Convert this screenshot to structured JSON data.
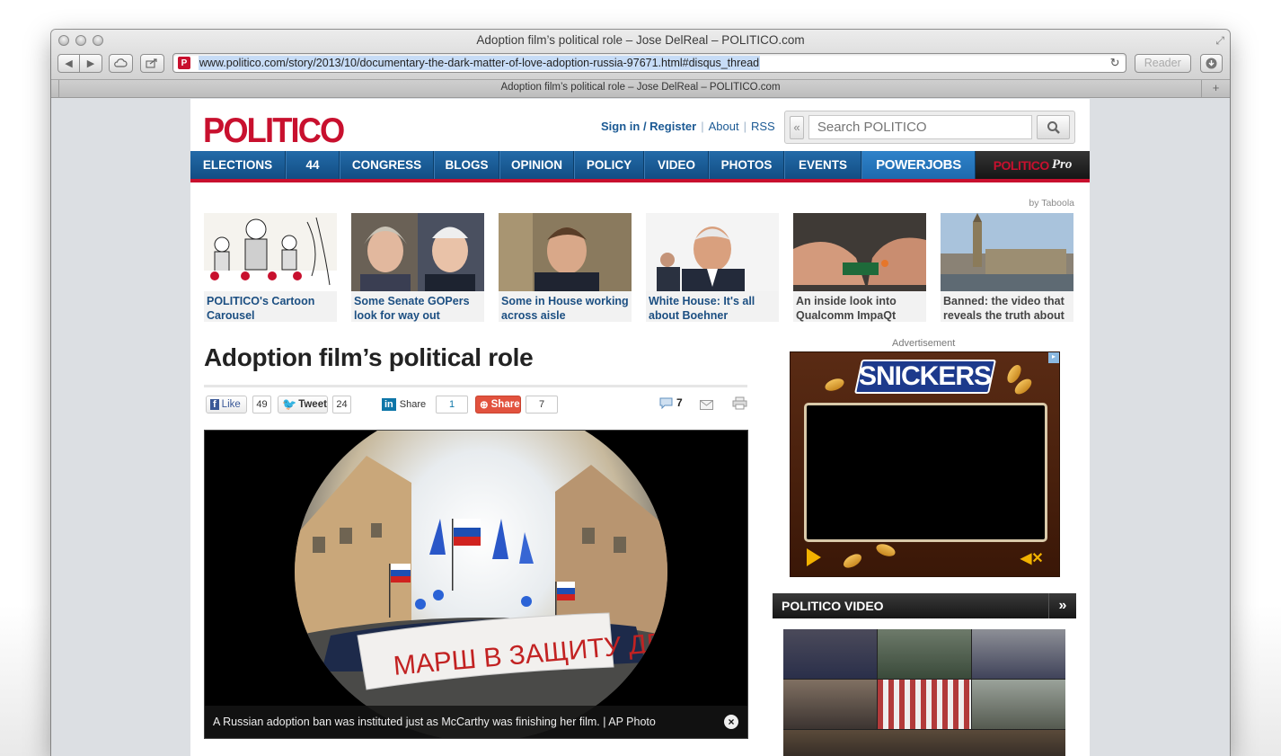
{
  "window": {
    "title": "Adoption film’s political role – Jose DelReal – POLITICO.com",
    "url": "www.politico.com/story/2013/10/documentary-the-dark-matter-of-love-adoption-russia-97671.html#disqus_thread",
    "reader_label": "Reader",
    "tab_title": "Adoption film’s political role – Jose DelReal – POLITICO.com"
  },
  "header": {
    "logo": "POLITICO",
    "signin": "Sign in / Register",
    "about": "About",
    "rss": "RSS",
    "search_placeholder": "Search POLITICO"
  },
  "nav": {
    "items": [
      "ELECTIONS",
      "44",
      "CONGRESS",
      "BLOGS",
      "OPINION",
      "POLICY",
      "VIDEO",
      "PHOTOS",
      "EVENTS"
    ],
    "powerjobs": "POWERJOBS",
    "pro_brand": "POLITICO",
    "pro_suffix": "Pro"
  },
  "taboola": {
    "label": "by Taboola",
    "cards": [
      {
        "caption": "POLITICO's Cartoon Carousel"
      },
      {
        "caption": "Some Senate GOPers look for way out"
      },
      {
        "caption": "Some in House working across aisle"
      },
      {
        "caption": "White House: It's all about Boehner"
      },
      {
        "caption": "An inside look into Qualcomm ImpaQt"
      },
      {
        "caption": "Banned: the video that reveals the truth about"
      }
    ]
  },
  "article": {
    "headline": "Adoption film’s political role",
    "share": {
      "fb_like": "Like",
      "fb_count": "49",
      "tweet": "Tweet",
      "tweet_count": "24",
      "linkedin": "Share",
      "linkedin_count": "1",
      "share": "Share",
      "share_count": "7",
      "comment_count": "7"
    },
    "photo_banner_text": "МАРШ В ЗАЩИТУ ДЕТЕЙ",
    "photo_caption": "A Russian adoption ban was instituted just as McCarthy was finishing her film. | AP Photo"
  },
  "sidebar": {
    "ad_label": "Advertisement",
    "ad_brand": "SNICKERS",
    "video_title": "POLITICO VIDEO",
    "video_more": "»"
  },
  "colors": {
    "brand_red": "#c8102e",
    "nav_blue": "#1c5a94",
    "link_blue": "#1c4f82"
  }
}
